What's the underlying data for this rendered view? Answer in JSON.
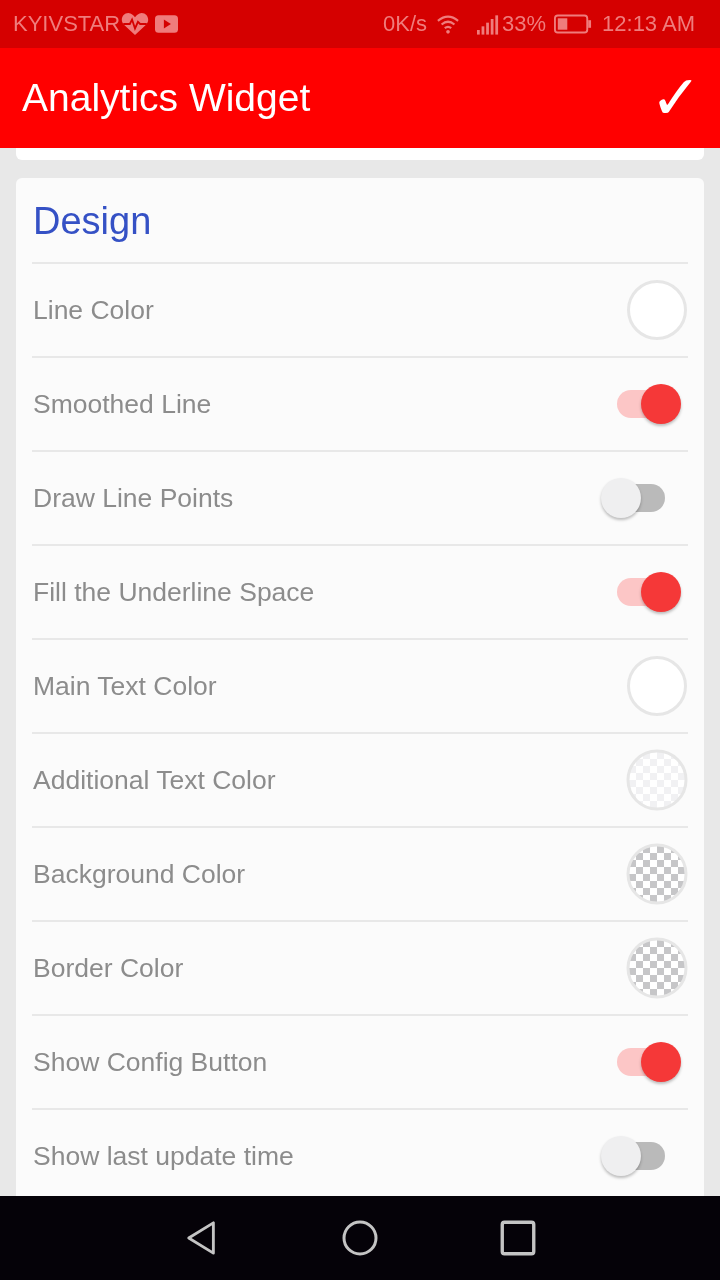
{
  "status_bar": {
    "carrier": "KYIVSTAR",
    "speed": "0K/s",
    "battery": "33%",
    "time": "12:13 AM"
  },
  "app_bar": {
    "title": "Analytics Widget",
    "confirm": "✓"
  },
  "section": {
    "title": "Design",
    "rows": [
      {
        "label": "Line Color",
        "kind": "color",
        "checkered": false,
        "color": "#ffffff"
      },
      {
        "label": "Smoothed Line",
        "kind": "switch",
        "on": true
      },
      {
        "label": "Draw Line Points",
        "kind": "switch",
        "on": false
      },
      {
        "label": "Fill the Underline Space",
        "kind": "switch",
        "on": true
      },
      {
        "label": "Main Text Color",
        "kind": "color",
        "checkered": false,
        "color": "#ffffff"
      },
      {
        "label": "Additional Text Color",
        "kind": "color",
        "checkered": true,
        "faded": true
      },
      {
        "label": "Background Color",
        "kind": "color",
        "checkered": true,
        "faded": false
      },
      {
        "label": "Border Color",
        "kind": "color",
        "checkered": true,
        "faded": false
      },
      {
        "label": "Show Config Button",
        "kind": "switch",
        "on": true
      },
      {
        "label": "Show last update time",
        "kind": "switch",
        "on": false
      }
    ]
  }
}
